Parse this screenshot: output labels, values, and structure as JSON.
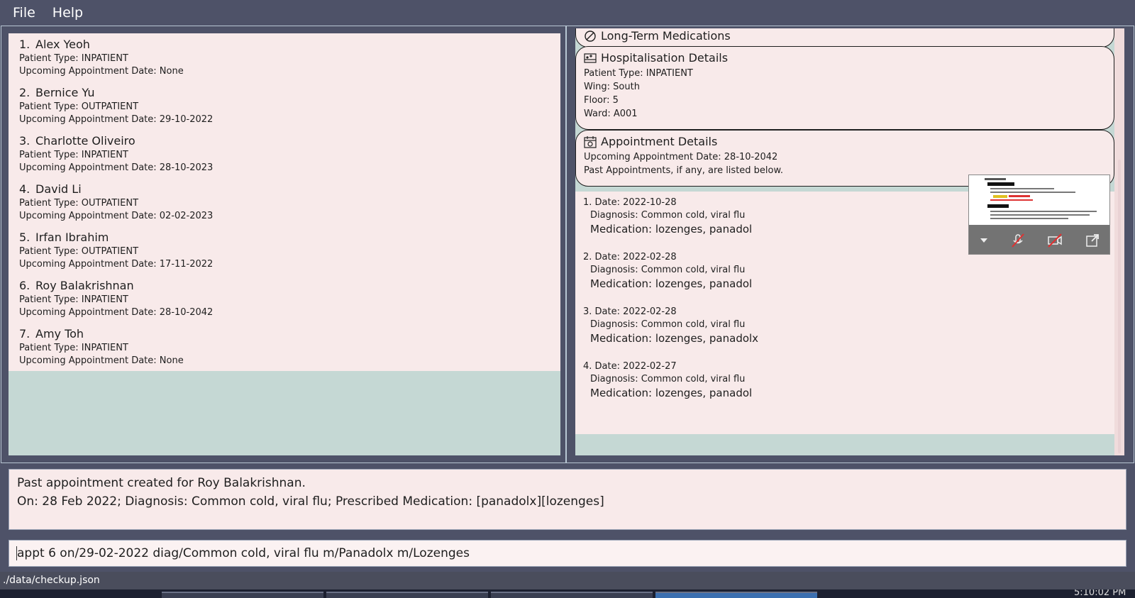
{
  "menu": {
    "file_label": "File",
    "help_label": "Help"
  },
  "patients": [
    {
      "index": "1.",
      "name": "Alex Yeoh",
      "type": "Patient Type: INPATIENT",
      "appt": "Upcoming Appointment Date: None"
    },
    {
      "index": "2.",
      "name": "Bernice Yu",
      "type": "Patient Type: OUTPATIENT",
      "appt": "Upcoming Appointment Date: 29-10-2022"
    },
    {
      "index": "3.",
      "name": "Charlotte Oliveiro",
      "type": "Patient Type: INPATIENT",
      "appt": "Upcoming Appointment Date: 28-10-2023"
    },
    {
      "index": "4.",
      "name": "David Li",
      "type": "Patient Type: OUTPATIENT",
      "appt": "Upcoming Appointment Date: 02-02-2023"
    },
    {
      "index": "5.",
      "name": "Irfan Ibrahim",
      "type": "Patient Type: OUTPATIENT",
      "appt": "Upcoming Appointment Date: 17-11-2022"
    },
    {
      "index": "6.",
      "name": "Roy Balakrishnan",
      "type": "Patient Type: INPATIENT",
      "appt": "Upcoming Appointment Date: 28-10-2042"
    },
    {
      "index": "7.",
      "name": "Amy Toh",
      "type": "Patient Type: INPATIENT",
      "appt": "Upcoming Appointment Date: None"
    }
  ],
  "details": {
    "medications_title": "Long-Term Medications",
    "hospitalisation": {
      "title": "Hospitalisation Details",
      "type": "Patient Type: INPATIENT",
      "wing": "Wing: South",
      "floor": "Floor: 5",
      "ward": "Ward: A001"
    },
    "appointment": {
      "title": "Appointment Details",
      "upcoming": "Upcoming Appointment Date: 28-10-2042",
      "note": "Past Appointments, if any, are listed below."
    },
    "past_appointments": [
      {
        "date": "1. Date: 2022-10-28",
        "diagnosis": "Diagnosis: Common cold, viral flu",
        "medication": "Medication: lozenges, panadol"
      },
      {
        "date": "2. Date: 2022-02-28",
        "diagnosis": "Diagnosis: Common cold, viral flu",
        "medication": "Medication: lozenges, panadol"
      },
      {
        "date": "3. Date: 2022-02-28",
        "diagnosis": "Diagnosis: Common cold, viral flu",
        "medication": "Medication: lozenges, panadolx"
      },
      {
        "date": "4. Date: 2022-02-27",
        "diagnosis": "Diagnosis: Common cold, viral flu",
        "medication": "Medication: lozenges, panadol"
      }
    ]
  },
  "result": {
    "line1": "Past appointment created for Roy Balakrishnan.",
    "line2": "On: 28 Feb 2022; Diagnosis: Common cold, viral flu; Prescribed Medication: [panadolx][lozenges]"
  },
  "command": {
    "value": "appt 6 on/29-02-2022 diag/Common cold, viral flu m/Panadolx m/Lozenges"
  },
  "status": {
    "file_path": "./data/checkup.json"
  },
  "taskbar": {
    "clock": "5:10:02 PM"
  },
  "colors": {
    "background": "#4e5268",
    "card": "#f8eaea",
    "list_bg": "#c5d8d4"
  },
  "icons": [
    "pill-icon",
    "hospital-bed-icon",
    "calendar-icon",
    "mic-off-icon",
    "camera-off-icon",
    "popout-icon"
  ]
}
